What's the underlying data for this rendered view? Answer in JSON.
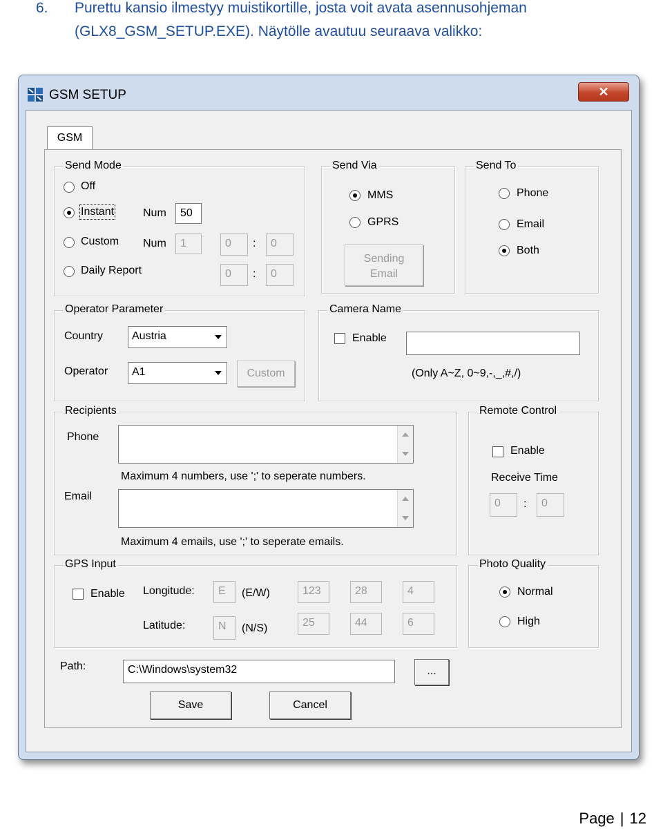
{
  "doc": {
    "step_number": "6.",
    "line1": "Purettu kansio ilmestyy muistikortille, josta voit avata asennusohjeman",
    "line2": "(GLX8_GSM_SETUP.EXE). Näytölle avautuu seuraava valikko:",
    "footer_page_label": "Page",
    "footer_sep": "|",
    "footer_page_number": "12"
  },
  "window": {
    "title": "GSM SETUP",
    "close_glyph": "✕",
    "tab_label": "GSM"
  },
  "send_mode": {
    "title": "Send Mode",
    "off": "Off",
    "instant": "Instant",
    "custom": "Custom",
    "daily_report": "Daily Report",
    "num_label": "Num",
    "instant_num": "50",
    "custom_num": "1",
    "custom_from": "0",
    "custom_to": "0",
    "daily_from": "0",
    "daily_to": "0",
    "colon": ":",
    "selected": "Instant"
  },
  "send_via": {
    "title": "Send Via",
    "mms": "MMS",
    "gprs": "GPRS",
    "sending_email_line1": "Sending",
    "sending_email_line2": "Email",
    "selected": "MMS"
  },
  "send_to": {
    "title": "Send To",
    "phone": "Phone",
    "email": "Email",
    "both": "Both",
    "selected": "Both"
  },
  "operator": {
    "title": "Operator Parameter",
    "country_label": "Country",
    "country_value": "Austria",
    "operator_label": "Operator",
    "operator_value": "A1",
    "custom_button": "Custom"
  },
  "camera": {
    "title": "Camera Name",
    "enable": "Enable",
    "name_value": "",
    "hint": "(Only A~Z, 0~9,-,_,#,/)"
  },
  "recipients": {
    "title": "Recipients",
    "phone_label": "Phone",
    "phone_value": "",
    "phone_hint": "Maximum 4 numbers, use ';' to  seperate  numbers.",
    "email_label": "Email",
    "email_value": "",
    "email_hint": "Maximum 4 emails, use ';' to seperate emails."
  },
  "remote_control": {
    "title": "Remote Control",
    "enable": "Enable",
    "receive_time_label": "Receive Time",
    "from": "0",
    "to": "0",
    "colon": ":"
  },
  "gps": {
    "title": "GPS Input",
    "enable": "Enable",
    "longitude_label": "Longitude:",
    "longitude_dir": "E",
    "longitude_dir_hint": "(E/W)",
    "longitude_deg": "123",
    "longitude_min": "28",
    "longitude_sec": "4",
    "latitude_label": "Latitude:",
    "latitude_dir": "N",
    "latitude_dir_hint": "(N/S)",
    "latitude_deg": "25",
    "latitude_min": "44",
    "latitude_sec": "6"
  },
  "photo_quality": {
    "title": "Photo Quality",
    "normal": "Normal",
    "high": "High",
    "selected": "Normal"
  },
  "path": {
    "label": "Path:",
    "value": "C:\\Windows\\system32",
    "browse": "..."
  },
  "actions": {
    "save": "Save",
    "cancel": "Cancel"
  },
  "colors": {
    "doc_text": "#1f4e9c",
    "window_frame": "#cfdcee",
    "dialog_bg": "#f0f0f0",
    "close_button": "#c4452a"
  }
}
